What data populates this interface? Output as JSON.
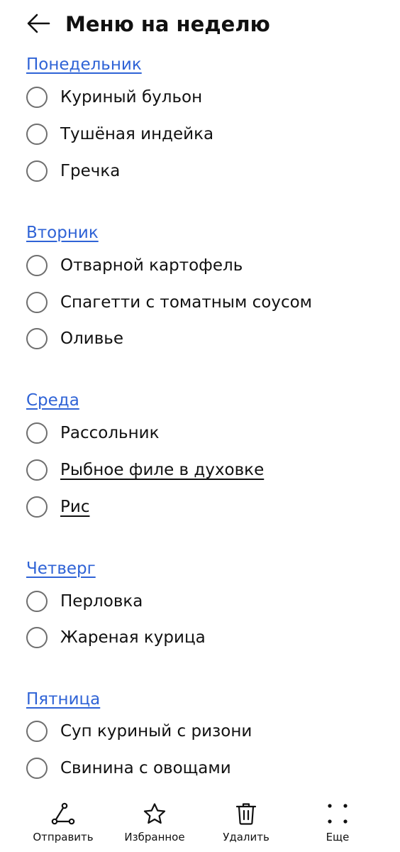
{
  "header": {
    "title": "Меню на неделю",
    "back_icon": "arrow-left-icon"
  },
  "days": [
    {
      "name": "Понедельник",
      "items": [
        "Куриный бульон",
        "Тушёная индейка",
        "Гречка"
      ]
    },
    {
      "name": "Вторник",
      "items": [
        "Отварной картофель",
        "Спагетти с томатным соусом",
        "Оливье"
      ]
    },
    {
      "name": "Среда",
      "items": [
        "Рассольник",
        "Рыбное филе в духовке",
        "Рис"
      ]
    },
    {
      "name": "Четверг",
      "items": [
        "Перловка",
        "Жареная курица"
      ]
    },
    {
      "name": "Пятница",
      "items": [
        "Суп куриный с ризони",
        "Свинина с овощами"
      ]
    }
  ],
  "bottom_nav": {
    "send": {
      "label": "Отправить",
      "icon": "share-icon"
    },
    "favorite": {
      "label": "Избранное",
      "icon": "star-icon"
    },
    "delete": {
      "label": "Удалить",
      "icon": "trash-icon"
    },
    "more": {
      "label": "Еще",
      "icon": "more-dots-icon"
    }
  },
  "colors": {
    "link": "#2f63d6",
    "text": "#111111",
    "radio_border": "#6e6e6e"
  }
}
